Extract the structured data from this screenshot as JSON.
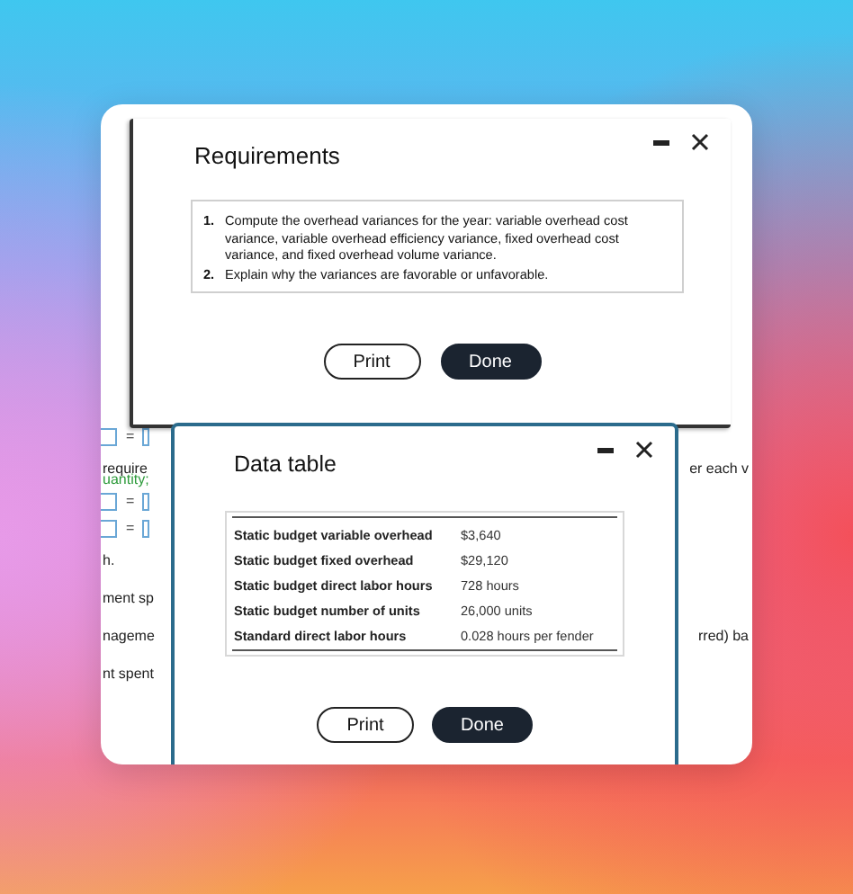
{
  "background_page": {
    "rows": [
      {
        "kind": "equation",
        "left": "="
      },
      {
        "kind": "text",
        "left": "require",
        "right": "er each v"
      },
      {
        "kind": "green",
        "left": "uantity;"
      },
      {
        "kind": "equation",
        "left": "="
      },
      {
        "kind": "equation",
        "left": "="
      },
      {
        "kind": "text",
        "left": "h."
      },
      {
        "kind": "text",
        "left": "ment sp"
      },
      {
        "kind": "text",
        "left": "nageme",
        "right": "rred) ba"
      },
      {
        "kind": "text",
        "left": "nt spent"
      }
    ]
  },
  "requirements_dialog": {
    "title": "Requirements",
    "items": [
      {
        "number": "1.",
        "text": "Compute the overhead variances for the year: variable overhead cost variance, variable overhead efficiency variance, fixed overhead cost variance, and fixed overhead volume variance."
      },
      {
        "number": "2.",
        "text": "Explain why the variances are favorable or unfavorable."
      }
    ],
    "buttons": [
      {
        "label": "Print",
        "kind": "secondary"
      },
      {
        "label": "Done",
        "kind": "primary"
      }
    ]
  },
  "data_table_dialog": {
    "title": "Data table",
    "rows": [
      {
        "label": "Static budget variable overhead",
        "value": "$3,640"
      },
      {
        "label": "Static budget fixed overhead",
        "value": "$29,120"
      },
      {
        "label": "Static budget direct labor hours",
        "value": "728 hours"
      },
      {
        "label": "Static budget number of units",
        "value": "26,000 units"
      },
      {
        "label": "Standard direct labor hours",
        "value": "0.028 hours per fender"
      }
    ],
    "buttons": [
      {
        "label": "Print",
        "kind": "secondary"
      },
      {
        "label": "Done",
        "kind": "primary"
      }
    ]
  }
}
